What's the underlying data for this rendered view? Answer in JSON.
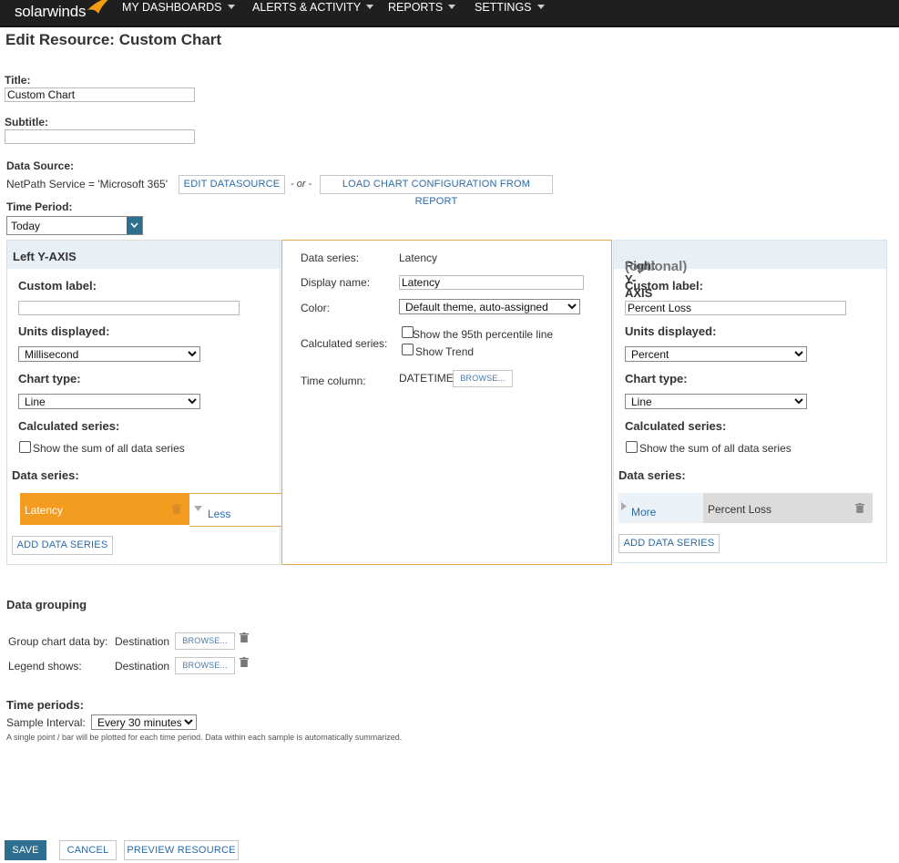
{
  "nav": {
    "logo": "solarwinds",
    "items": [
      {
        "label": "MY DASHBOARDS"
      },
      {
        "label": "ALERTS & ACTIVITY"
      },
      {
        "label": "REPORTS"
      },
      {
        "label": "SETTINGS"
      }
    ]
  },
  "page_title": "Edit Resource: Custom Chart",
  "form": {
    "title_label": "Title:",
    "title_value": "Custom Chart",
    "subtitle_label": "Subtitle:",
    "subtitle_value": "",
    "datasource_label": "Data Source:",
    "datasource_value": "NetPath Service = 'Microsoft 365'",
    "edit_datasource": "EDIT DATASOURCE",
    "or_text": "- or -",
    "load_config": "LOAD CHART CONFIGURATION FROM REPORT",
    "time_period_label": "Time Period:",
    "time_period_value": "Today"
  },
  "left_axis": {
    "header": "Left Y-AXIS",
    "custom_label": "Custom label:",
    "custom_label_value": "",
    "units_label": "Units displayed:",
    "units_value": "Millisecond",
    "chart_type_label": "Chart type:",
    "chart_type_value": "Line",
    "calc_label": "Calculated series:",
    "sum_label": "Show the sum of all data series",
    "data_series_label": "Data series:",
    "series": [
      {
        "name": "Latency",
        "toggle": "Less"
      }
    ],
    "add_series": "ADD DATA SERIES"
  },
  "series_detail": {
    "data_series_label": "Data series:",
    "data_series_value": "Latency",
    "display_name_label": "Display name:",
    "display_name_value": "Latency",
    "color_label": "Color:",
    "color_value": "Default theme, auto-assigned",
    "calc_label": "Calculated series:",
    "p95_label": "Show the 95th percentile line",
    "trend_label": "Show Trend",
    "time_col_label": "Time column:",
    "time_col_value": "DATETIME",
    "browse": "BROWSE..."
  },
  "right_axis": {
    "header": "Right Y-AXIS",
    "header_optional": "(optional)",
    "custom_label": "Custom label:",
    "custom_label_value": "Percent Loss",
    "units_label": "Units displayed:",
    "units_value": "Percent",
    "chart_type_label": "Chart type:",
    "chart_type_value": "Line",
    "calc_label": "Calculated series:",
    "sum_label": "Show the sum of all data series",
    "data_series_label": "Data series:",
    "series": [
      {
        "name": "Percent Loss",
        "toggle": "More"
      }
    ],
    "add_series": "ADD DATA SERIES"
  },
  "grouping": {
    "heading": "Data grouping",
    "group_by_label": "Group chart data by:",
    "group_by_value": "Destination",
    "legend_label": "Legend shows:",
    "legend_value": "Destination",
    "browse": "BROWSE..."
  },
  "time_periods": {
    "heading": "Time periods:",
    "sample_label": "Sample Interval:",
    "sample_value": "Every 30 minutes",
    "note": "A single point / bar will be plotted for each time period. Data within each sample is automatically summarized."
  },
  "actions": {
    "save": "SAVE",
    "cancel": "CANCEL",
    "preview": "PREVIEW RESOURCE"
  },
  "colors": {
    "nav_bg": "#1f1f1f",
    "accent_orange": "#f39c12",
    "save_bg": "#2e6e8e",
    "select_button": "#2e6e8e",
    "link_blue": "#2a6aa8"
  }
}
